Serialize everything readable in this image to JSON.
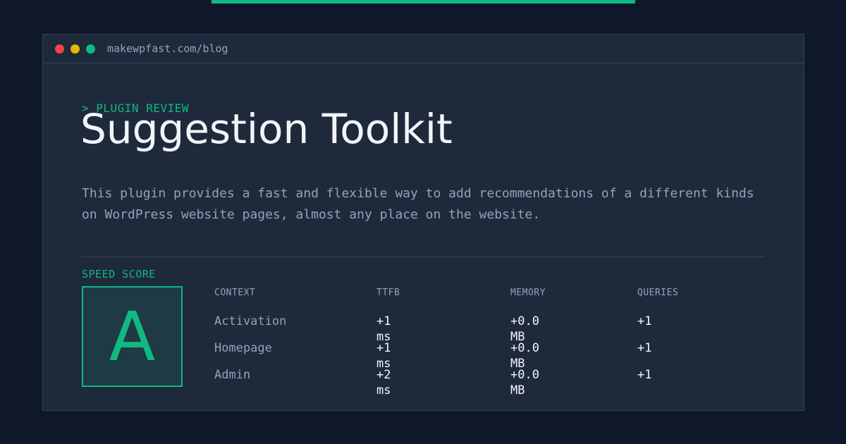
{
  "window": {
    "url": "makewpfast.com/blog"
  },
  "header": {
    "eyebrow": "> PLUGIN REVIEW",
    "title": "Suggestion Toolkit",
    "description": "This plugin provides a fast and flexible way to add recommendations of a different kinds on WordPress website pages, almost any place on the website."
  },
  "speed": {
    "label": "SPEED SCORE",
    "grade": "A"
  },
  "table": {
    "headers": [
      "CONTEXT",
      "TTFB",
      "MEMORY",
      "QUERIES"
    ],
    "rows": [
      {
        "context": "Activation",
        "ttfb": "+1 ms",
        "memory": "+0.0 MB",
        "queries": "+1"
      },
      {
        "context": "Homepage",
        "ttfb": "+1 ms",
        "memory": "+0.0 MB",
        "queries": "+1"
      },
      {
        "context": "Admin",
        "ttfb": "+2 ms",
        "memory": "+0.0 MB",
        "queries": "+1"
      }
    ]
  },
  "colors": {
    "background": "#0f172a",
    "panel": "#1e293b",
    "accent": "#10b981",
    "text": "#f1f5f9",
    "muted": "#94a3b8"
  }
}
